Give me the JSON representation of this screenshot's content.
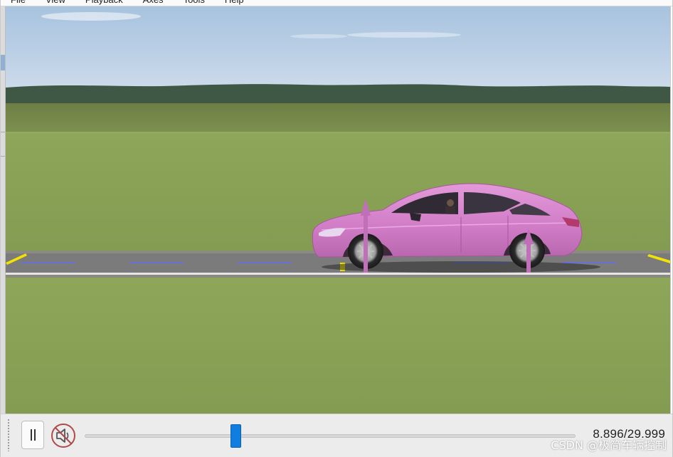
{
  "menubar": {
    "items": [
      "File",
      "View",
      "Playback",
      "Axes",
      "Tools",
      "Help"
    ]
  },
  "playback": {
    "pause_symbol": "||",
    "progress": 0.2983,
    "current_time": "8.896",
    "total_time": "29.999",
    "time_display": "8.896/29.999",
    "accent_color": "#0f7ee0"
  },
  "icons": {
    "pause": "pause-icon",
    "mute": "speaker-muted-icon"
  },
  "watermark": "CSDN @极简车辆控制",
  "scene": {
    "sky_color": "#b9cde3",
    "grass_color": "#8fa85a",
    "road_color": "#7b7b7b",
    "vehicle_color": "#d886cf",
    "marker_color": "#f2e400"
  }
}
